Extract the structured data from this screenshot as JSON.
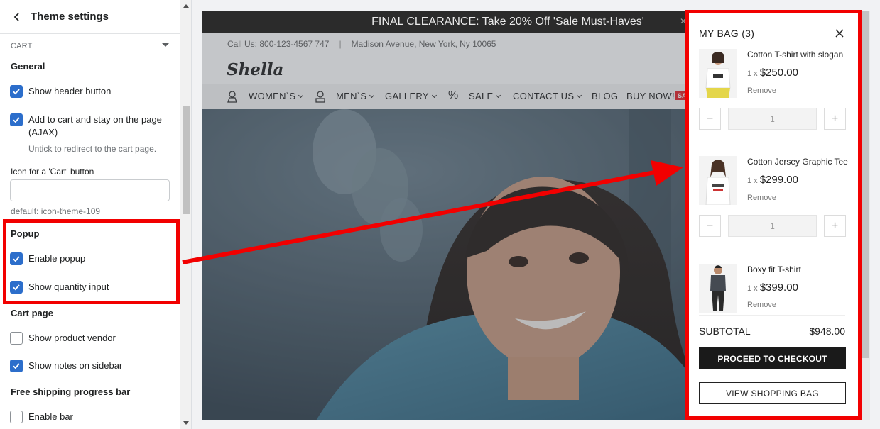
{
  "settings": {
    "title": "Theme settings",
    "section": "CART",
    "general": {
      "heading": "General",
      "show_header_button": "Show header button",
      "add_to_cart_ajax_line1": "Add to cart and stay on the page",
      "add_to_cart_ajax_line2": "(AJAX)",
      "add_to_cart_help": "Untick to redirect to the cart page.",
      "cart_icon_label": "Icon for a 'Cart' button",
      "cart_icon_value": "",
      "cart_icon_default": "default: icon-theme-109"
    },
    "popup": {
      "heading": "Popup",
      "enable_popup": "Enable popup",
      "show_quantity_input": "Show quantity input"
    },
    "cart_page": {
      "heading": "Cart page",
      "show_product_vendor": "Show product vendor",
      "show_notes_on_sidebar": "Show notes on sidebar"
    },
    "free_shipping": {
      "heading": "Free shipping progress bar",
      "enable_bar": "Enable bar"
    },
    "checked": {
      "show_header_button": true,
      "add_to_cart_ajax": true,
      "enable_popup": true,
      "show_quantity_input": true,
      "show_product_vendor": false,
      "show_notes_on_sidebar": true,
      "enable_bar": false
    }
  },
  "store": {
    "announcement": "FINAL CLEARANCE: Take 20% Off 'Sale Must-Haves'",
    "announcement_close": "✕",
    "phone": "Call Us: 800-123-4567 747",
    "contact_sep": "|",
    "address": "Madison Avenue, New York, Ny 10065",
    "logo": "Shella",
    "nav": {
      "womens": "WOMEN`S",
      "mens": "MEN`S",
      "gallery": "GALLERY",
      "percent": "%",
      "sale": "SALE",
      "contact": "CONTACT US",
      "blog": "BLOG",
      "buy_now": "BUY NOW!",
      "sale_badge": "SA"
    }
  },
  "cart": {
    "title": "MY BAG (3)",
    "items": [
      {
        "name": "Cotton T-shirt with slogan",
        "qty_prefix": "1 x",
        "price": "$250.00",
        "remove": "Remove",
        "qty": "1"
      },
      {
        "name": "Cotton Jersey Graphic Tee",
        "qty_prefix": "1 x",
        "price": "$299.00",
        "remove": "Remove",
        "qty": "1"
      },
      {
        "name": "Boxy fit T-shirt",
        "qty_prefix": "1 x",
        "price": "$399.00",
        "remove": "Remove"
      }
    ],
    "minus": "−",
    "plus": "+",
    "subtotal_label": "SUBTOTAL",
    "subtotal_value": "$948.00",
    "checkout": "PROCEED TO CHECKOUT",
    "view_bag": "VIEW SHOPPING BAG"
  },
  "colors": {
    "accent": "#2c6ecb",
    "annotation_red": "#f20000",
    "checkout_bg": "#1a1a1a",
    "announcement_bg": "#2b2b2b"
  }
}
